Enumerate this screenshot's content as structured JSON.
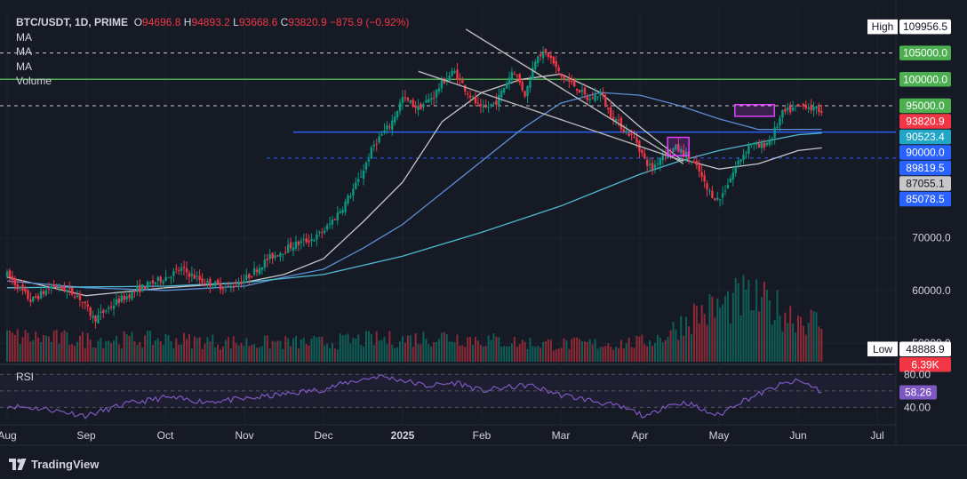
{
  "header": {
    "symbol": "BTC/USDT, 1D, PRIME",
    "open_label": "O",
    "open": "94696.8",
    "high_label": "H",
    "high": "94893.2",
    "low_label": "L",
    "low": "93668.6",
    "close_label": "C",
    "close": "93820.9",
    "change": "−875.9 (−0.92%)",
    "indicators": [
      "MA",
      "MA",
      "MA",
      "Volume"
    ]
  },
  "rsi_label": "RSI",
  "footer": {
    "brand": "TradingView",
    "logo_icon": "tradingview-logo-icon"
  },
  "colors": {
    "background": "#161a25",
    "up": "#089981",
    "down": "#f23645",
    "ma_fast": "#c7c7c7",
    "ma_mid": "#5b8ed6",
    "ma_slow": "#4fb8d0",
    "rsi": "#7e57c2",
    "support": "#2962ff",
    "resistance": "#4caf50",
    "box": "#e040fb"
  },
  "chart_data": {
    "type": "candlestick",
    "x_tick_labels": [
      "Aug",
      "Sep",
      "Oct",
      "Nov",
      "Dec",
      "2025",
      "Feb",
      "Mar",
      "Apr",
      "May",
      "Jun",
      "Jul"
    ],
    "price_ticks": [
      {
        "label": "70000.0",
        "value": 70000
      },
      {
        "label": "60000.0",
        "value": 60000
      },
      {
        "label": "50000.0",
        "value": 50000
      }
    ],
    "price_badges": [
      {
        "label": "High",
        "value_label": "109956.5",
        "value": 109956.5,
        "style": "outline"
      },
      {
        "label": "",
        "value_label": "105000.0",
        "value": 105000,
        "color": "#4caf50"
      },
      {
        "label": "",
        "value_label": "100000.0",
        "value": 100000,
        "color": "#4caf50"
      },
      {
        "label": "",
        "value_label": "95000.0",
        "value": 95000,
        "color": "#4caf50"
      },
      {
        "label": "",
        "value_label": "93820.9",
        "value": 93820.9,
        "color": "#f23645"
      },
      {
        "label": "",
        "value_label": "90523.4",
        "value": 90523.4,
        "color": "#22a6c7"
      },
      {
        "label": "",
        "value_label": "90000.0",
        "value": 90000,
        "color": "#2962ff"
      },
      {
        "label": "",
        "value_label": "89819.5",
        "value": 89819.5,
        "color": "#2962ff"
      },
      {
        "label": "",
        "value_label": "87055.1",
        "value": 87055.1,
        "color": "#c7c7c7"
      },
      {
        "label": "",
        "value_label": "85078.5",
        "value": 85078.5,
        "color": "#2962ff"
      },
      {
        "label": "Low",
        "value_label": "48888.9",
        "value": 48888.9,
        "style": "outline"
      },
      {
        "label": "",
        "value_label": "6.39K",
        "value": 6390,
        "color": "#f23645",
        "pane": "volume"
      }
    ],
    "rsi_ticks": [
      {
        "label": "80.00",
        "value": 80
      },
      {
        "label": "40.00",
        "value": 40
      }
    ],
    "rsi_badge": {
      "label": "58.26",
      "value": 58.26
    },
    "price_range": [
      48000,
      112000
    ],
    "rsi_range": [
      20,
      90
    ],
    "horizontal_levels": [
      {
        "value": 105000,
        "style": "dashed",
        "color": "#c7c7c7"
      },
      {
        "value": 100000,
        "style": "solid",
        "color": "#4caf50"
      },
      {
        "value": 95000,
        "style": "dashed",
        "color": "#c7c7c7"
      },
      {
        "value": 90000,
        "style": "solid",
        "color": "#2962ff"
      },
      {
        "value": 85078.5,
        "style": "dashed",
        "color": "#2962ff"
      }
    ],
    "trendlines": [
      {
        "from": {
          "month": 5.8,
          "value": 109500
        },
        "to": {
          "month": 8.55,
          "value": 84000
        }
      },
      {
        "from": {
          "month": 5.2,
          "value": 101500
        },
        "to": {
          "month": 8.55,
          "value": 84500
        }
      }
    ],
    "boxes": [
      {
        "from_month": 8.35,
        "to_month": 8.62,
        "low": 85500,
        "high": 89000
      },
      {
        "from_month": 9.2,
        "to_month": 9.7,
        "low": 93000,
        "high": 95200
      }
    ],
    "price_path": [
      [
        0,
        63000
      ],
      [
        0.3,
        58000
      ],
      [
        0.6,
        61000
      ],
      [
        0.9,
        59000
      ],
      [
        1.1,
        54500
      ],
      [
        1.4,
        58000
      ],
      [
        1.7,
        60500
      ],
      [
        2.0,
        62500
      ],
      [
        2.2,
        64000
      ],
      [
        2.5,
        61500
      ],
      [
        2.8,
        60500
      ],
      [
        3.0,
        62000
      ],
      [
        3.3,
        66000
      ],
      [
        3.6,
        68500
      ],
      [
        3.9,
        70000
      ],
      [
        4.05,
        72000
      ],
      [
        4.25,
        76000
      ],
      [
        4.45,
        81000
      ],
      [
        4.65,
        88000
      ],
      [
        4.85,
        91500
      ],
      [
        5.0,
        96500
      ],
      [
        5.2,
        94500
      ],
      [
        5.4,
        97000
      ],
      [
        5.5,
        99500
      ],
      [
        5.65,
        101500
      ],
      [
        5.8,
        98000
      ],
      [
        6.0,
        94000
      ],
      [
        6.2,
        96000
      ],
      [
        6.4,
        102000
      ],
      [
        6.55,
        97000
      ],
      [
        6.7,
        105000
      ],
      [
        6.85,
        104500
      ],
      [
        7.0,
        100500
      ],
      [
        7.2,
        98500
      ],
      [
        7.35,
        96000
      ],
      [
        7.5,
        97500
      ],
      [
        7.6,
        94000
      ],
      [
        7.8,
        90500
      ],
      [
        7.95,
        88500
      ],
      [
        8.05,
        85000
      ],
      [
        8.15,
        83000
      ],
      [
        8.3,
        86000
      ],
      [
        8.45,
        87000
      ],
      [
        8.6,
        85500
      ],
      [
        8.75,
        82500
      ],
      [
        8.85,
        79000
      ],
      [
        9.0,
        77000
      ],
      [
        9.1,
        80000
      ],
      [
        9.25,
        84500
      ],
      [
        9.4,
        88000
      ],
      [
        9.5,
        87000
      ],
      [
        9.65,
        88500
      ],
      [
        9.8,
        93500
      ],
      [
        9.95,
        94500
      ],
      [
        10.1,
        95200
      ],
      [
        10.2,
        94200
      ],
      [
        10.3,
        94200
      ]
    ],
    "ma_series": [
      {
        "color_key": "ma_fast",
        "points": [
          [
            0,
            62500
          ],
          [
            1,
            59000
          ],
          [
            2,
            60500
          ],
          [
            3,
            61500
          ],
          [
            3.5,
            63000
          ],
          [
            4,
            66000
          ],
          [
            4.5,
            73000
          ],
          [
            5,
            80500
          ],
          [
            5.5,
            92000
          ],
          [
            6,
            97500
          ],
          [
            6.5,
            100000
          ],
          [
            7,
            101000
          ],
          [
            7.5,
            97500
          ],
          [
            8,
            91000
          ],
          [
            8.5,
            85000
          ],
          [
            9,
            83000
          ],
          [
            9.5,
            84000
          ],
          [
            10,
            86500
          ],
          [
            10.3,
            87000
          ]
        ]
      },
      {
        "color_key": "ma_mid",
        "points": [
          [
            0,
            61800
          ],
          [
            1,
            60500
          ],
          [
            2,
            60000
          ],
          [
            3,
            60800
          ],
          [
            3.5,
            62500
          ],
          [
            4,
            64000
          ],
          [
            4.5,
            68000
          ],
          [
            5,
            72500
          ],
          [
            5.5,
            78500
          ],
          [
            6,
            84500
          ],
          [
            6.5,
            90500
          ],
          [
            7,
            95500
          ],
          [
            7.5,
            97500
          ],
          [
            8,
            97000
          ],
          [
            8.5,
            95000
          ],
          [
            9,
            92500
          ],
          [
            9.5,
            90500
          ],
          [
            10.3,
            90523
          ]
        ]
      },
      {
        "color_key": "ma_slow",
        "points": [
          [
            0,
            60500
          ],
          [
            2,
            60800
          ],
          [
            3,
            61500
          ],
          [
            4,
            63000
          ],
          [
            5,
            66500
          ],
          [
            6,
            71000
          ],
          [
            7,
            76000
          ],
          [
            7.5,
            79000
          ],
          [
            8,
            82000
          ],
          [
            8.5,
            84500
          ],
          [
            9,
            86500
          ],
          [
            9.5,
            88000
          ],
          [
            10,
            89500
          ],
          [
            10.3,
            89819
          ]
        ]
      }
    ],
    "volume_profile": [
      [
        0,
        0.4
      ],
      [
        1,
        0.35
      ],
      [
        2,
        0.35
      ],
      [
        3,
        0.3
      ],
      [
        4,
        0.3
      ],
      [
        4.5,
        0.35
      ],
      [
        5,
        0.35
      ],
      [
        5.5,
        0.4
      ],
      [
        6,
        0.35
      ],
      [
        6.5,
        0.3
      ],
      [
        7,
        0.28
      ],
      [
        7.5,
        0.28
      ],
      [
        8,
        0.3
      ],
      [
        8.3,
        0.4
      ],
      [
        8.7,
        0.75
      ],
      [
        9,
        0.85
      ],
      [
        9.3,
        1.0
      ],
      [
        9.6,
        0.9
      ],
      [
        9.9,
        0.75
      ],
      [
        10.3,
        0.6
      ]
    ],
    "rsi_path": [
      [
        0,
        42
      ],
      [
        0.5,
        38
      ],
      [
        1,
        30
      ],
      [
        1.5,
        44
      ],
      [
        2,
        52
      ],
      [
        2.5,
        47
      ],
      [
        3,
        50
      ],
      [
        3.5,
        56
      ],
      [
        4,
        62
      ],
      [
        4.3,
        70
      ],
      [
        4.7,
        78
      ],
      [
        5,
        73
      ],
      [
        5.3,
        66
      ],
      [
        5.7,
        70
      ],
      [
        6,
        60
      ],
      [
        6.3,
        64
      ],
      [
        6.6,
        67
      ],
      [
        7,
        55
      ],
      [
        7.3,
        50
      ],
      [
        7.6,
        44
      ],
      [
        7.9,
        36
      ],
      [
        8.1,
        28
      ],
      [
        8.3,
        42
      ],
      [
        8.6,
        46
      ],
      [
        8.8,
        36
      ],
      [
        9,
        30
      ],
      [
        9.2,
        44
      ],
      [
        9.5,
        56
      ],
      [
        9.8,
        68
      ],
      [
        10.0,
        72
      ],
      [
        10.2,
        65
      ],
      [
        10.3,
        58.26
      ]
    ]
  }
}
